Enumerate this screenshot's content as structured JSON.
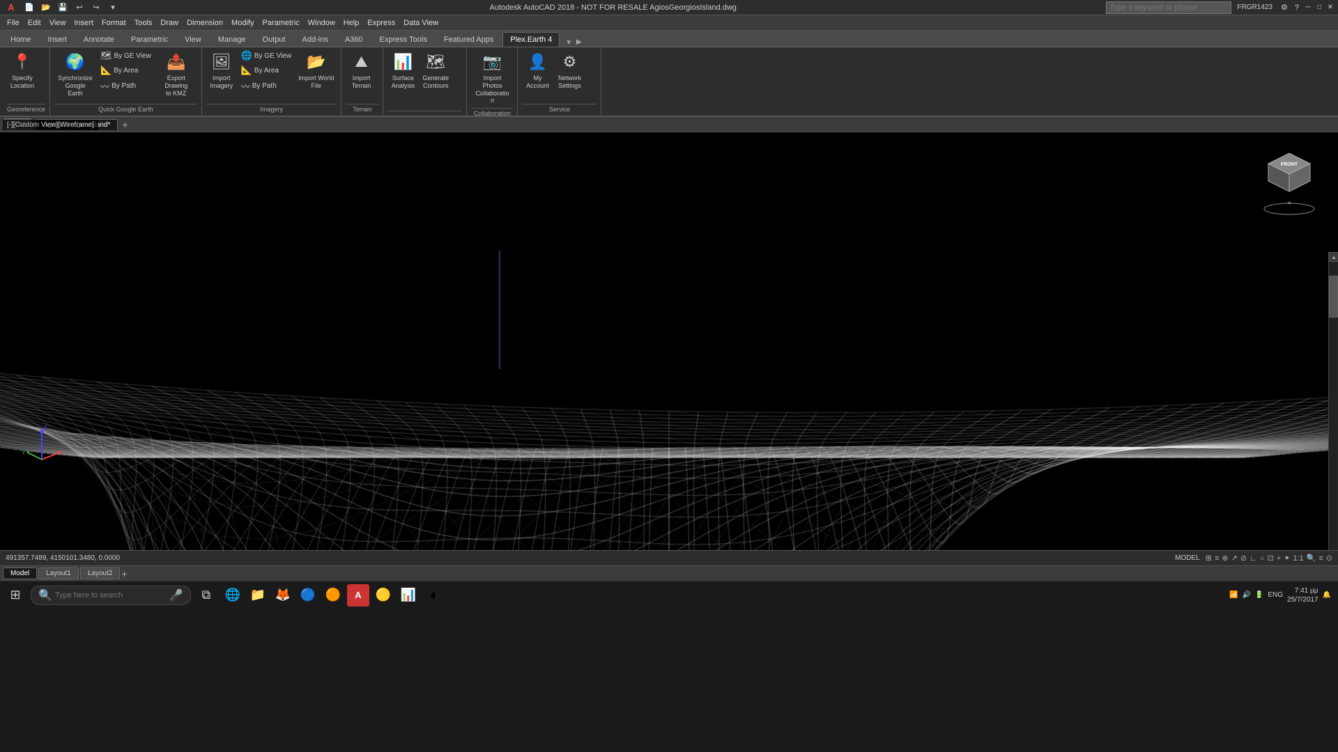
{
  "title_bar": {
    "app_icon": "A",
    "title": "Autodesk AutoCAD 2018 - NOT FOR RESALE    AgiosGeorgiosIsland.dwg",
    "search_placeholder": "Type a keyword or phrase",
    "user": "FRGR1423",
    "btn_minimize": "─",
    "btn_restore": "□",
    "btn_close": "✕"
  },
  "qat": {
    "buttons": [
      "💾",
      "↩",
      "↪",
      "▾"
    ]
  },
  "menu_bar": {
    "items": [
      "File",
      "Edit",
      "View",
      "Insert",
      "Format",
      "Tools",
      "Draw",
      "Dimension",
      "Modify",
      "Parametric",
      "Window",
      "Help",
      "Express",
      "Data View"
    ]
  },
  "ribbon_tabs": {
    "tabs": [
      "Home",
      "Insert",
      "Annotate",
      "Parametric",
      "View",
      "Manage",
      "Output",
      "Add-ins",
      "A360",
      "Express Tools",
      "Featured Apps",
      "Plex.Earth 4"
    ],
    "active": "Plex.Earth 4"
  },
  "ribbon_groups": [
    {
      "name": "Georeference",
      "label": "Georeference",
      "buttons": [
        {
          "icon": "📍",
          "label": "Specify\nLocation",
          "name": "specify-location"
        }
      ]
    },
    {
      "name": "Quick Google Earth",
      "label": "Quick Google Earth",
      "buttons": [
        {
          "icon": "🌍",
          "label": "Synchronize\nGoogle Earth",
          "name": "synchronize-google-earth"
        }
      ],
      "small_buttons": [
        {
          "icon": "🗺",
          "label": "By GE View",
          "name": "export-by-ge-view"
        },
        {
          "icon": "📐",
          "label": "By Area",
          "name": "export-by-area"
        },
        {
          "icon": "〰",
          "label": "By Path",
          "name": "export-by-path"
        },
        {
          "label": "Export Drawing\nto KMZ",
          "icon": "📤",
          "name": "export-drawing-kmz"
        }
      ]
    },
    {
      "name": "Imagery",
      "label": "Imagery",
      "buttons": [
        {
          "icon": "🖼",
          "label": "Import\nImagery",
          "name": "import-imagery"
        }
      ],
      "small_buttons": [
        {
          "icon": "🌐",
          "label": "By GE View",
          "name": "imagery-by-ge-view"
        },
        {
          "icon": "📐",
          "label": "By Area",
          "name": "imagery-by-area"
        },
        {
          "icon": "〰",
          "label": "By Path",
          "name": "imagery-by-path"
        },
        {
          "label": "Import World\nFile",
          "icon": "📂",
          "name": "import-world-file"
        }
      ]
    },
    {
      "name": "Terrain",
      "label": "Terrain",
      "buttons": [
        {
          "icon": "⛰",
          "label": "Import\nTerrain",
          "name": "import-terrain"
        }
      ]
    },
    {
      "name": "Surface Analysis",
      "label": "",
      "buttons": [
        {
          "icon": "📊",
          "label": "Surface\nAnalysis",
          "name": "surface-analysis"
        },
        {
          "icon": "🗺",
          "label": "Generate\nContours",
          "name": "generate-contours"
        }
      ]
    },
    {
      "name": "Collaboration",
      "label": "Collaboration",
      "buttons": [
        {
          "icon": "📷",
          "label": "Import\nPhotos",
          "name": "import-photos"
        }
      ]
    },
    {
      "name": "Service",
      "label": "Service",
      "buttons": [
        {
          "icon": "👤",
          "label": "My\nAccount",
          "name": "my-account"
        },
        {
          "icon": "⚙",
          "label": "Network\nSettings",
          "name": "network-settings"
        }
      ]
    }
  ],
  "command_bar": {
    "start_label": "Start",
    "tab_label": "AgiosGeorgiosIsland*",
    "tab_add": "+"
  },
  "viewport": {
    "view_label": "[-][Custom View][Wireframe]",
    "background_color": "#000000"
  },
  "viewcube": {
    "label": "FRONT"
  },
  "coord_bar": {
    "coordinates": "491357.7489, 4150101.3480, 0.0000",
    "mode": "MODEL"
  },
  "layout_tabs": {
    "tabs": [
      "Model",
      "Layout1",
      "Layout2"
    ],
    "active": "Model",
    "add": "+"
  },
  "taskbar": {
    "search_placeholder": "Type here to search",
    "time": "7:41 μμ",
    "date": "25/7/2017",
    "language": "ENG",
    "apps": [
      "⊞",
      "🔍",
      "🌐",
      "📁",
      "🦊",
      "🔵",
      "🟠",
      "🔴",
      "🟡",
      "📊",
      "♦"
    ]
  },
  "status_bar": {
    "icons": [
      "⊞",
      "≡",
      "⊕",
      "↗",
      "⊘",
      "∟",
      "○",
      "⊡",
      "✦",
      "1:1",
      "+",
      "🔍",
      "≡",
      "⊙"
    ]
  }
}
